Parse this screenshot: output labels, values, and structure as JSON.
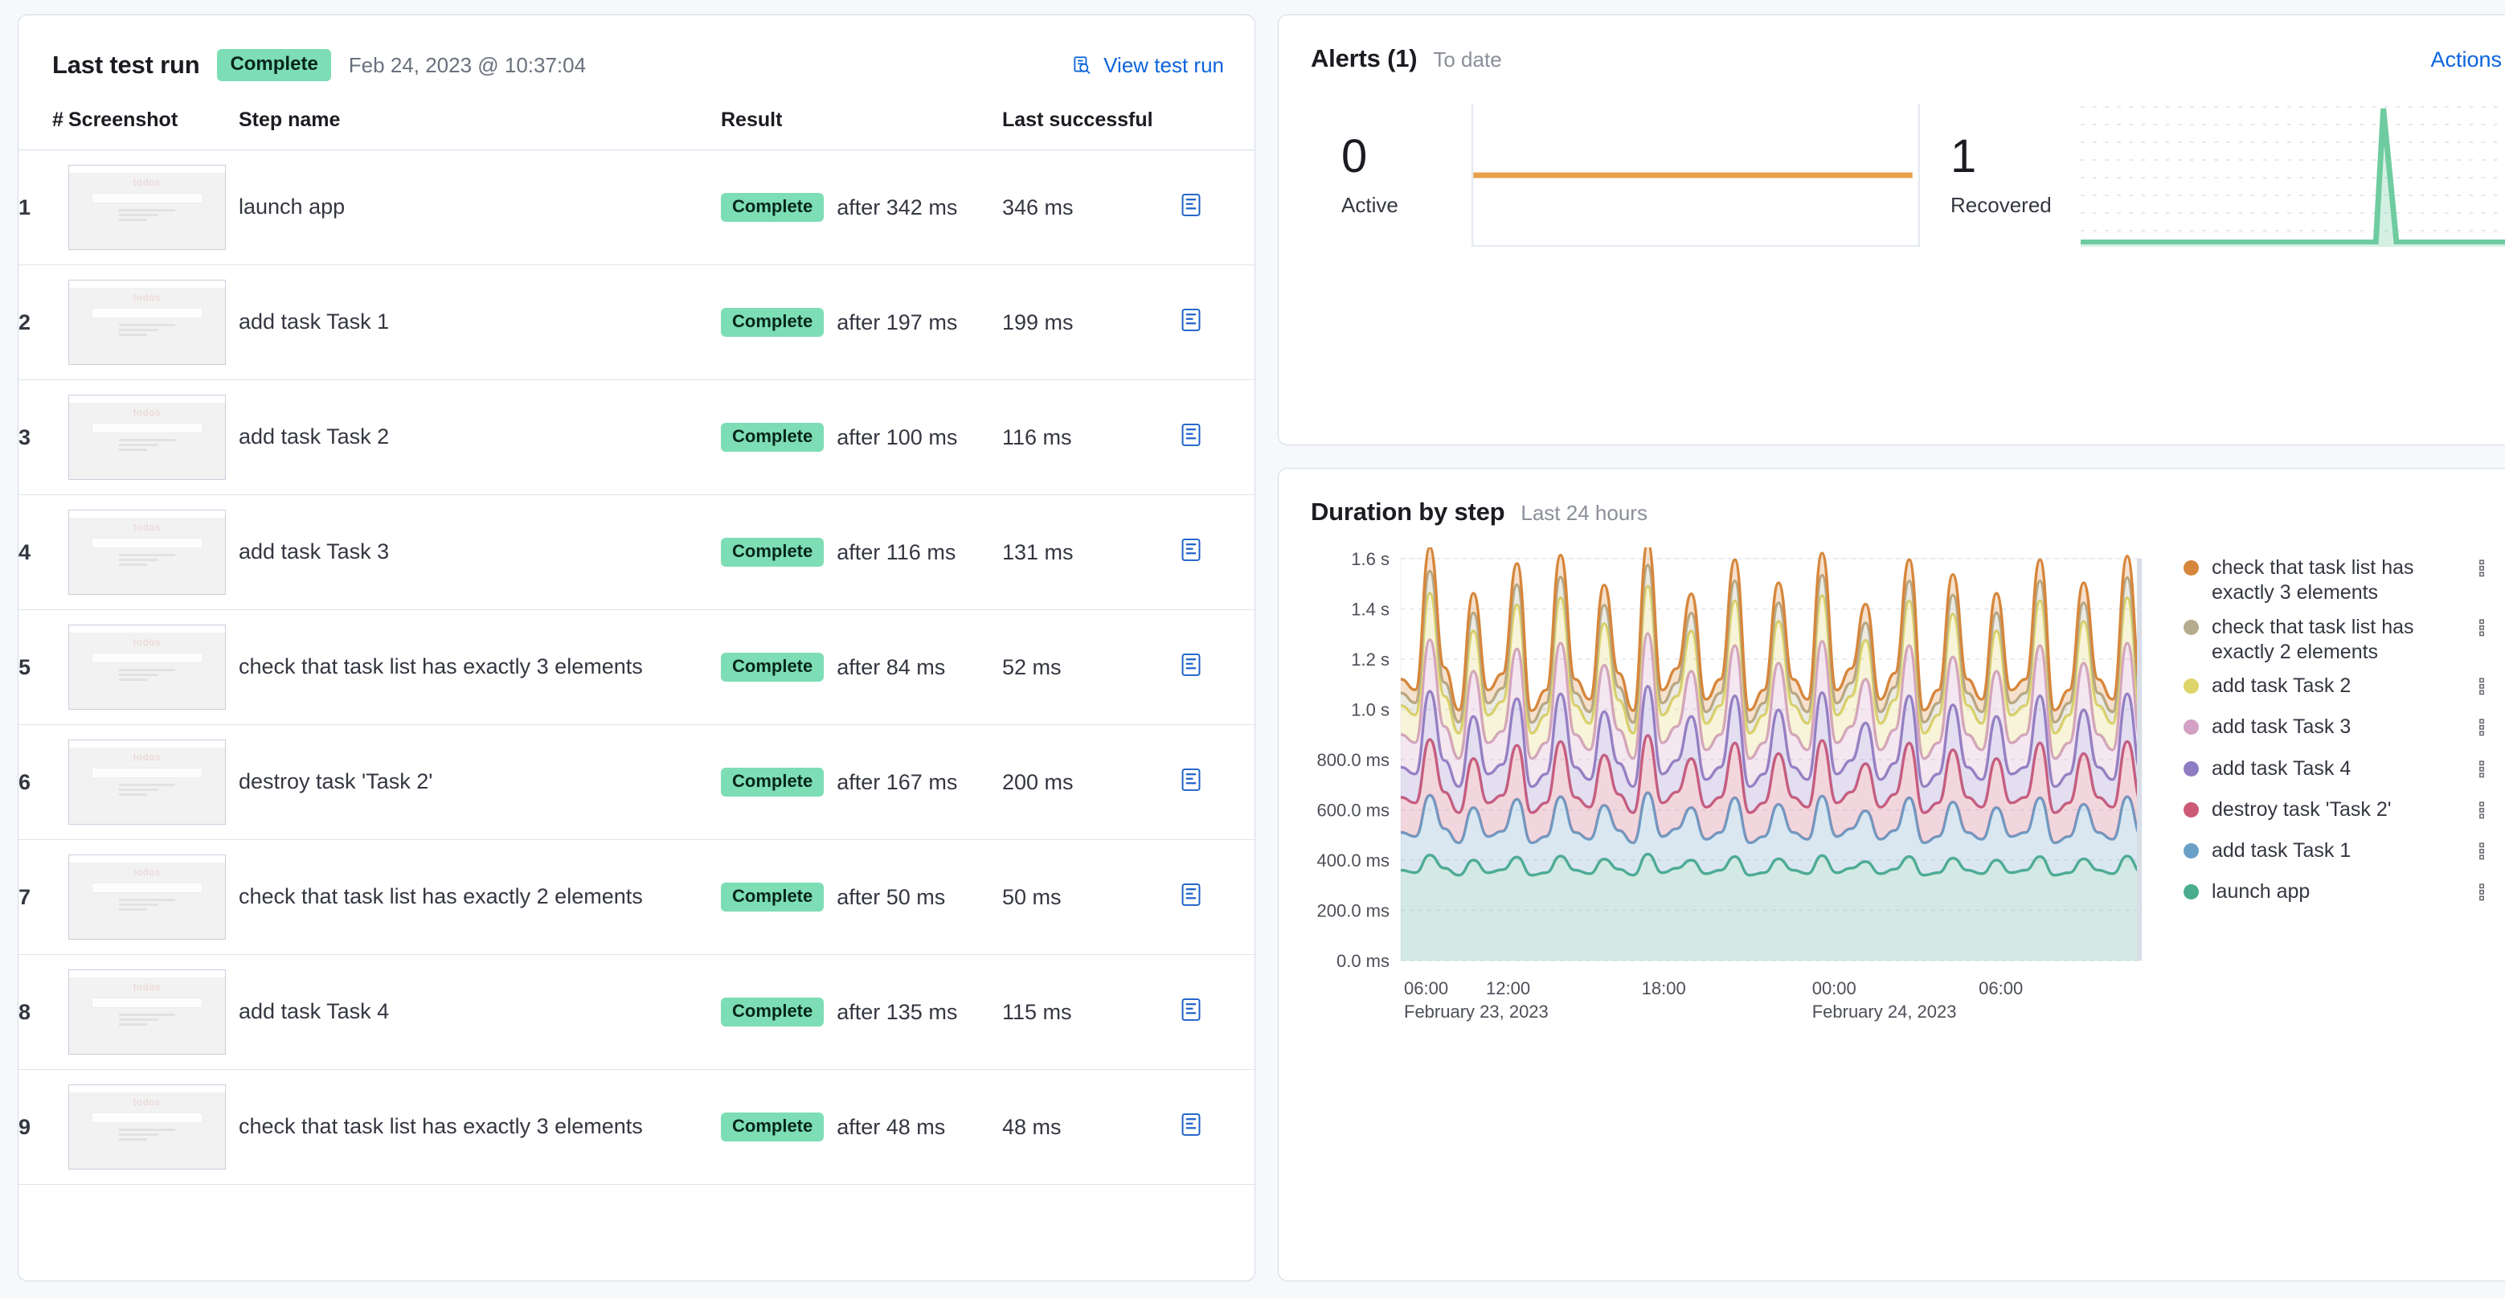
{
  "last_test_run": {
    "title": "Last test run",
    "status_badge": "Complete",
    "timestamp": "Feb 24, 2023 @ 10:37:04",
    "view_link": "View test run",
    "view_icon": "inspect-icon",
    "columns": {
      "num": "#",
      "screenshot": "Screenshot",
      "step_name": "Step name",
      "result": "Result",
      "last_successful": "Last successful"
    },
    "rows": [
      {
        "num": "1",
        "step_name": "launch app",
        "badge": "Complete",
        "after": "after 342 ms",
        "last_successful": "346 ms"
      },
      {
        "num": "2",
        "step_name": "add task Task 1",
        "badge": "Complete",
        "after": "after 197 ms",
        "last_successful": "199 ms"
      },
      {
        "num": "3",
        "step_name": "add task Task 2",
        "badge": "Complete",
        "after": "after 100 ms",
        "last_successful": "116 ms"
      },
      {
        "num": "4",
        "step_name": "add task Task 3",
        "badge": "Complete",
        "after": "after 116 ms",
        "last_successful": "131 ms"
      },
      {
        "num": "5",
        "step_name": "check that task list has exactly 3 elements",
        "badge": "Complete",
        "after": "after 84 ms",
        "last_successful": "52 ms"
      },
      {
        "num": "6",
        "step_name": "destroy task 'Task 2'",
        "badge": "Complete",
        "after": "after 167 ms",
        "last_successful": "200 ms"
      },
      {
        "num": "7",
        "step_name": "check that task list has exactly 2 elements",
        "badge": "Complete",
        "after": "after 50 ms",
        "last_successful": "50 ms"
      },
      {
        "num": "8",
        "step_name": "add task Task 4",
        "badge": "Complete",
        "after": "after 135 ms",
        "last_successful": "115 ms"
      },
      {
        "num": "9",
        "step_name": "check that task list has exactly 3 elements",
        "badge": "Complete",
        "after": "after 48 ms",
        "last_successful": "48 ms"
      }
    ],
    "thumbnail_title": "todos",
    "row_action_icon": "document-log-icon"
  },
  "alerts": {
    "title": "Alerts (1)",
    "subtitle": "To date",
    "actions_label": "Actions",
    "actions_icon": "chevron-down-icon",
    "metrics": [
      {
        "value": "0",
        "label": "Active",
        "color": "#e7a14c"
      },
      {
        "value": "1",
        "label": "Recovered",
        "color": "#6fcca0"
      }
    ]
  },
  "duration": {
    "title": "Duration by step",
    "subtitle": "Last 24 hours"
  },
  "chart_data": {
    "type": "area",
    "title": "Duration by step",
    "subtitle": "Last 24 hours",
    "stacked": true,
    "grid": true,
    "legend_position": "right",
    "xlabel": "",
    "ylabel": "",
    "ylim": [
      0,
      1600
    ],
    "ytick_labels": [
      "1.6 s",
      "1.4 s",
      "1.2 s",
      "1.0 s",
      "800.0 ms",
      "600.0 ms",
      "400.0 ms",
      "200.0 ms",
      "0.0 ms"
    ],
    "ytick_values": [
      1600,
      1400,
      1200,
      1000,
      800,
      600,
      400,
      200,
      0
    ],
    "xtick_labels": [
      {
        "time": "06:00",
        "date": "February 23, 2023"
      },
      {
        "time": "12:00",
        "date": ""
      },
      {
        "time": "18:00",
        "date": ""
      },
      {
        "time": "00:00",
        "date": "February 24, 2023"
      },
      {
        "time": "06:00",
        "date": ""
      }
    ],
    "series": [
      {
        "name": "check that task list has exactly 3 elements",
        "color": "#d6863b",
        "values": [
          55,
          52,
          95,
          60,
          48,
          78,
          52,
          58,
          85,
          47,
          52,
          88,
          55,
          50,
          80,
          56,
          47,
          90,
          52,
          58,
          77,
          50,
          55,
          85,
          48,
          52,
          80,
          55,
          50,
          88,
          52,
          58,
          75,
          50,
          56,
          85,
          48,
          52,
          82,
          55,
          50,
          78,
          52,
          55,
          85,
          48,
          52,
          80,
          55,
          50,
          86,
          52
        ]
      },
      {
        "name": "check that task list has exactly 2 elements",
        "color": "#b5ac8e",
        "short": "exactly 2 elements",
        "values": [
          50,
          48,
          88,
          55,
          44,
          72,
          48,
          53,
          80,
          43,
          48,
          82,
          50,
          46,
          74,
          51,
          43,
          84,
          48,
          53,
          71,
          46,
          50,
          79,
          44,
          48,
          74,
          50,
          46,
          81,
          48,
          53,
          69,
          46,
          51,
          79,
          44,
          48,
          76,
          50,
          46,
          72,
          48,
          50,
          79,
          44,
          48,
          74,
          50,
          46,
          80,
          48
        ]
      },
      {
        "name": "add task Task 2",
        "color": "#ded56a",
        "values": [
          115,
          110,
          185,
          120,
          100,
          160,
          110,
          118,
          175,
          100,
          110,
          180,
          115,
          105,
          165,
          118,
          100,
          188,
          110,
          120,
          160,
          105,
          115,
          178,
          100,
          110,
          166,
          115,
          105,
          182,
          110,
          120,
          155,
          105,
          118,
          178,
          100,
          110,
          170,
          115,
          105,
          160,
          110,
          115,
          178,
          100,
          110,
          166,
          115,
          105,
          180,
          110
        ]
      },
      {
        "name": "add task Task 3",
        "color": "#d2a1c3",
        "values": [
          130,
          125,
          205,
          135,
          112,
          180,
          124,
          132,
          198,
          112,
          124,
          202,
          130,
          118,
          185,
          133,
          112,
          210,
          124,
          135,
          180,
          118,
          130,
          200,
          112,
          124,
          186,
          130,
          118,
          204,
          124,
          135,
          174,
          118,
          133,
          200,
          112,
          124,
          191,
          130,
          118,
          180,
          124,
          130,
          200,
          112,
          124,
          186,
          130,
          118,
          202,
          124
        ]
      },
      {
        "name": "add task Task 4",
        "color": "#8e7cc3",
        "values": [
          120,
          115,
          192,
          126,
          104,
          168,
          115,
          123,
          186,
          104,
          115,
          190,
          120,
          110,
          173,
          124,
          104,
          196,
          115,
          126,
          168,
          110,
          120,
          188,
          104,
          115,
          174,
          120,
          110,
          191,
          115,
          126,
          162,
          110,
          124,
          188,
          104,
          115,
          179,
          120,
          110,
          168,
          115,
          120,
          188,
          104,
          115,
          174,
          120,
          110,
          190,
          115
        ]
      },
      {
        "name": "destroy task 'Task 2'",
        "color": "#cc5a77",
        "values": [
          140,
          134,
          222,
          146,
          120,
          195,
          134,
          143,
          215,
          120,
          134,
          220,
          140,
          128,
          200,
          144,
          120,
          228,
          134,
          146,
          195,
          128,
          140,
          218,
          120,
          134,
          202,
          140,
          128,
          221,
          134,
          146,
          188,
          128,
          144,
          218,
          120,
          134,
          208,
          140,
          128,
          195,
          134,
          140,
          218,
          120,
          134,
          202,
          140,
          128,
          220,
          134
        ]
      },
      {
        "name": "add task Task 1",
        "color": "#6a9fc8",
        "values": [
          150,
          144,
          238,
          157,
          129,
          209,
          144,
          153,
          230,
          129,
          144,
          236,
          150,
          137,
          214,
          154,
          129,
          244,
          144,
          157,
          209,
          137,
          150,
          234,
          129,
          144,
          217,
          150,
          137,
          237,
          144,
          157,
          202,
          137,
          154,
          234,
          129,
          144,
          223,
          150,
          137,
          209,
          144,
          150,
          234,
          129,
          144,
          217,
          150,
          137,
          236,
          144
        ]
      },
      {
        "name": "launch app",
        "color": "#4aad8e",
        "values": [
          360,
          350,
          420,
          368,
          340,
          400,
          350,
          362,
          412,
          340,
          350,
          416,
          360,
          346,
          404,
          364,
          340,
          424,
          350,
          368,
          400,
          346,
          360,
          414,
          340,
          350,
          405,
          360,
          346,
          418,
          350,
          368,
          394,
          346,
          364,
          414,
          340,
          350,
          408,
          360,
          346,
          400,
          350,
          360,
          414,
          340,
          350,
          405,
          360,
          346,
          416,
          350
        ]
      }
    ]
  }
}
